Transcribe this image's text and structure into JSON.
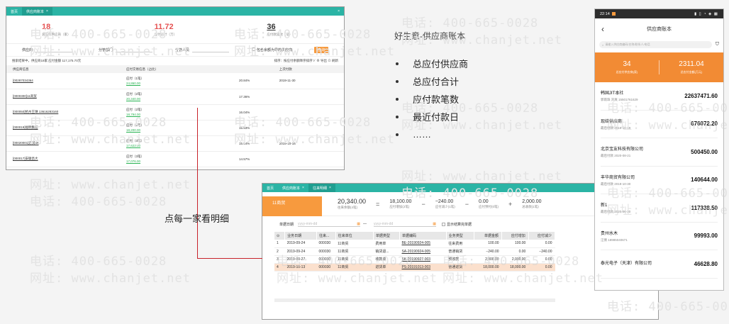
{
  "watermark": {
    "phone": "电话: 400-665-0028",
    "site": "网址: www.chanjet.net"
  },
  "win1": {
    "tabs": [
      {
        "label": "首页"
      },
      {
        "label": "供应商账本",
        "close": "×"
      }
    ],
    "close_all": "×",
    "stats": [
      {
        "value": "18",
        "label": "总应付供应商（家）"
      },
      {
        "value": "11.72",
        "label": "应付合计（万）"
      },
      {
        "value": "36",
        "label": "应付款笔数（笔）"
      }
    ],
    "filters": {
      "supplier": "供应商",
      "dept": "分管部门",
      "person": "分管人员",
      "include_zero": "包含余额为零的供应商",
      "query": "查询"
    },
    "summary_left": "搜索结果中，供应商18家    应付金额 117,175.70元",
    "summary_right": "排序：按应付余额降序排序∨    ⊕ 导出    ⊙ 刷新",
    "columns": [
      "供应商信息",
      "应付交易信息（占比）",
      "上次付款"
    ],
    "rows": [
      {
        "name": "[00287034364",
        "label": "应付（1笔）",
        "amount": "24,860.00",
        "pct": "20.84%",
        "last": "2019-11-30"
      },
      {
        "name": "[0000300]11商贸",
        "label": "应付（2笔）",
        "amount": "20,340.00",
        "pct": "17.36%",
        "last": ""
      },
      {
        "name": "[000050]杭州王琳  13616283160",
        "label": "应付（2笔）",
        "amount": "18,794.00",
        "pct": "16.04%",
        "last": ""
      },
      {
        "name": "[000019]福明集团",
        "label": "应付（1笔）",
        "amount": "18,200.00",
        "pct": "15.53%",
        "last": ""
      },
      {
        "name": "[00020001]迅贸86",
        "label": "应付（3笔）",
        "amount": "17,622.00",
        "pct": "15.04%",
        "last": "2019-10-16"
      },
      {
        "name": "[000017]安徽昌大",
        "label": "应付（3笔）",
        "amount": "17,076.00",
        "pct": "14.57%",
        "last": ""
      }
    ]
  },
  "annotation": "点每一家看明细",
  "win2": {
    "tabs": [
      {
        "label": "首页"
      },
      {
        "label": "供应商账本",
        "close": "×"
      },
      {
        "label": "往来明细",
        "close": "×"
      }
    ],
    "close_all": "×",
    "supplier": "11商贸",
    "balance": {
      "value": "20,340.00",
      "label": "往来余额(4笔)"
    },
    "eq": "=",
    "ops": [
      "−",
      "−",
      "+"
    ],
    "parts": [
      {
        "value": "18,100.00",
        "label": "应付增加(2笔)"
      },
      {
        "value": "−240.00",
        "label": "应付减少(1笔)"
      },
      {
        "value": "0.00",
        "label": "应付预付(0笔)"
      },
      {
        "value": "2,000.00",
        "label": "总收款(1笔)"
      }
    ],
    "date_label": "单据日期",
    "date_ph": "yyyy-mm-dd",
    "date_sep": "—",
    "show_settled": "显示结算完单据",
    "columns": [
      "⊙",
      "业务日期",
      "往来...",
      "往来单位",
      "单据类型",
      "单据编码",
      "业务类型",
      "单据金额",
      "应付增加",
      "应付减少"
    ],
    "rows": [
      [
        "1",
        "2019-09-24",
        "000030",
        "11商贸",
        "费用单",
        "BE-20190924-005",
        "往来费用",
        "100.00",
        "100.00",
        "0.00"
      ],
      [
        "2",
        "2019-09-24",
        "000030",
        "11商贸",
        "销货退...",
        "SA-20190924-005",
        "普通销货",
        "−240.00",
        "0.00",
        "−240.00"
      ],
      [
        "3",
        "2019-09-27",
        "000030",
        "11商贸",
        "收款单",
        "SK-20190927-003",
        "预收款",
        "2,000.00",
        "2,000.00",
        "0.00"
      ],
      [
        "4",
        "2019-10-13",
        "000030",
        "11商贸",
        "进货单",
        "PS-20191013-003",
        "普通进货",
        "18,000.00",
        "18,000.00",
        "0.00"
      ]
    ]
  },
  "panel": {
    "title": "好生意-供应商账本",
    "items": [
      "总应付供应商",
      "总应付合计",
      "应付款笔数",
      "最近付款日",
      "……"
    ]
  },
  "phone": {
    "time": "22:14",
    "status_right": "▮ ▯ ◔ ◈ ▦",
    "back": "‹",
    "title": "供应商账本",
    "search_ph": "请输入供应商编码/名称/联系人/电话",
    "filter": "⛉",
    "stats": [
      {
        "value": "34",
        "label": "总应付供应商(家)"
      },
      {
        "value": "2311.04",
        "label": "总应付金额(万元)"
      }
    ],
    "items": [
      {
        "name": "韩国JIT本社",
        "sub": "郭雨珠 刘爽 15501761629",
        "amount": "22637471.60"
      },
      {
        "name": "现结供应商",
        "sub": "最后付款 2019-10-19",
        "amount": "676072.20"
      },
      {
        "name": "北京宝友科技有限公司",
        "sub": "最后付款 2020-08-21",
        "amount": "500450.00"
      },
      {
        "name": "丰华商贸有限公司",
        "sub": "最后付款 2019-10-30",
        "amount": "140644.00"
      },
      {
        "name": "新1",
        "sub": "最后付款 2020-06-30",
        "amount": "117338.50"
      },
      {
        "name": "贵州水木",
        "sub": "汪倩 18985040671",
        "amount": "99993.00"
      },
      {
        "name": "泰光电子（天津）有限公司",
        "sub": "",
        "amount": "46628.80"
      }
    ]
  }
}
